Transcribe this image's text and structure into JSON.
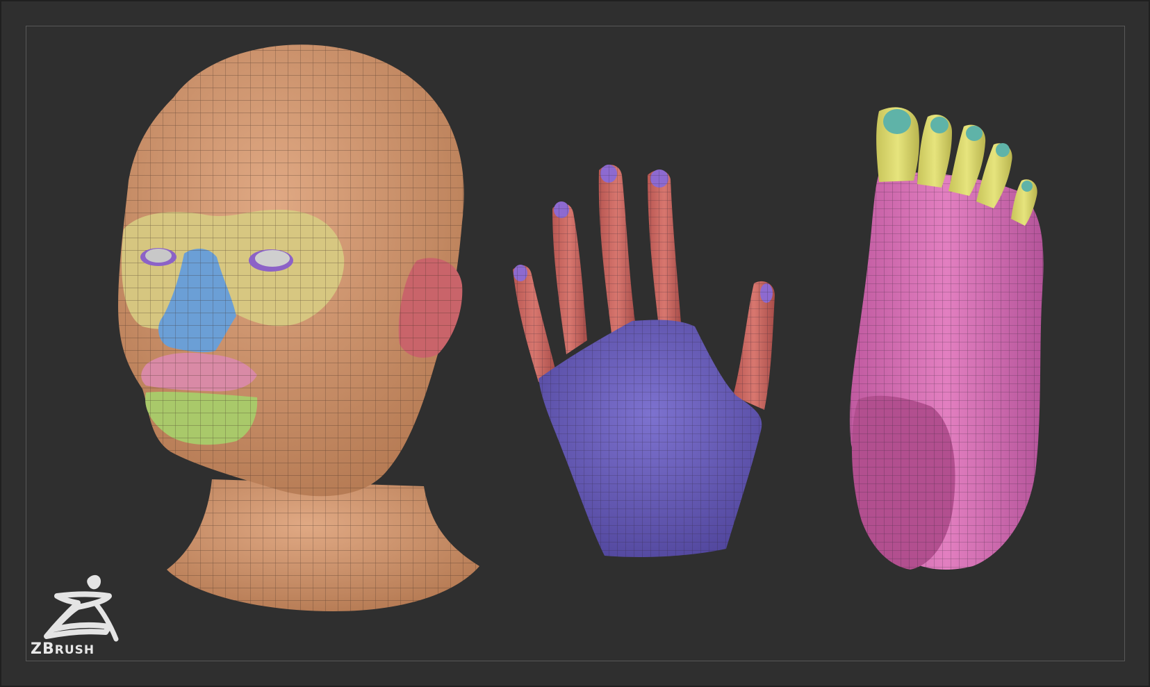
{
  "brand": {
    "logo_name": "zbrush-logo",
    "text_first": "ZB",
    "text_rest": "RUSH",
    "registered_mark": "®"
  },
  "colors": {
    "background": "#2f2f2f",
    "frame": "#595959",
    "head_skin": "#d49a70",
    "eye_zone": "#d7c982",
    "nose": "#6b9fd6",
    "lips_upper": "#d98aa6",
    "lips_lower": "#a9c96a",
    "ear": "#c9646a",
    "hand_fingers": "#cc6b66",
    "hand_back": "#6f63c2",
    "nails": "#8d6ad0",
    "foot": "#d772b4",
    "toes": "#d9d96e",
    "toenails": "#5fb3a8"
  },
  "models": [
    {
      "id": "head",
      "label": "head-model"
    },
    {
      "id": "hand",
      "label": "hand-model"
    },
    {
      "id": "foot",
      "label": "foot-model"
    }
  ]
}
